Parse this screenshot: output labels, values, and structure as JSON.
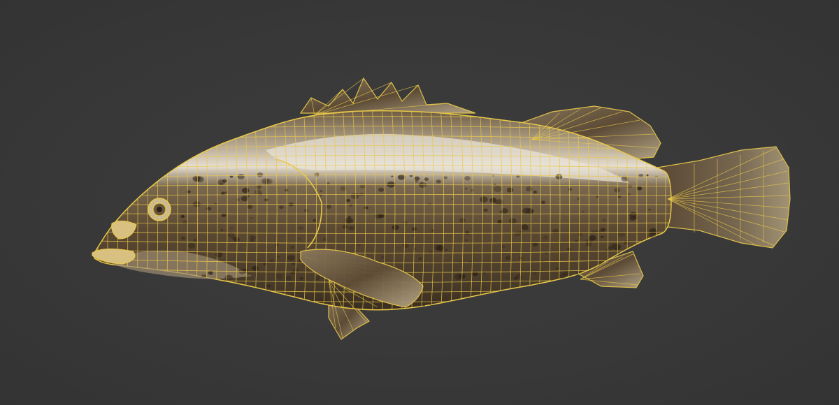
{
  "viewport": {
    "background_color": "#3a3a3a",
    "wireframe_color": "#e8c84a",
    "model": {
      "subject": "fish",
      "render_mode": "textured-wireframe-overlay",
      "body_colors": [
        "#5a4a36",
        "#3e3224",
        "#8a7a64",
        "#d8d0c4"
      ]
    }
  }
}
